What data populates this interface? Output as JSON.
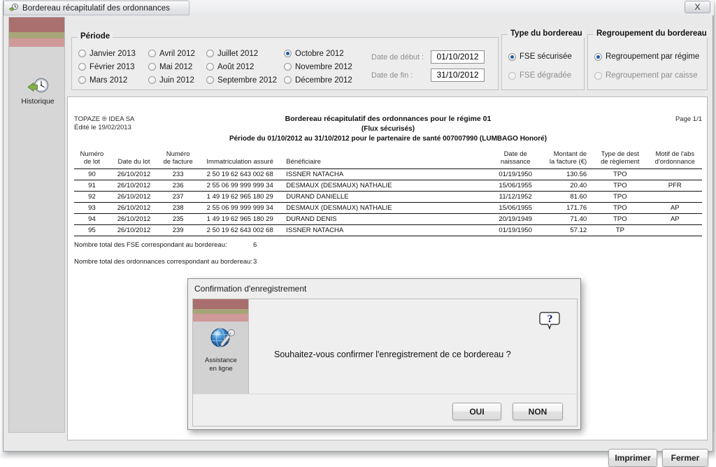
{
  "window": {
    "title": "Bordereau récapitulatif des ordonnances",
    "title_icon": "app-icon",
    "close_label": "X"
  },
  "sidebar": {
    "items": [
      {
        "label": "Historique",
        "icon": "clock-history-icon"
      }
    ]
  },
  "periode": {
    "legend": "Période",
    "months": [
      {
        "label": "Janvier 2013",
        "selected": false
      },
      {
        "label": "Avril 2012",
        "selected": false
      },
      {
        "label": "Juillet 2012",
        "selected": false
      },
      {
        "label": "Octobre 2012",
        "selected": true
      },
      {
        "label": "Février 2013",
        "selected": false
      },
      {
        "label": "Mai 2012",
        "selected": false
      },
      {
        "label": "Août 2012",
        "selected": false
      },
      {
        "label": "Novembre 2012",
        "selected": false
      },
      {
        "label": "Mars 2012",
        "selected": false
      },
      {
        "label": "Juin 2012",
        "selected": false
      },
      {
        "label": "Septembre 2012",
        "selected": false
      },
      {
        "label": "Décembre 2012",
        "selected": false
      }
    ],
    "date_debut_label": "Date de début :",
    "date_debut_value": "01/10/2012",
    "date_fin_label": "Date de fin :",
    "date_fin_value": "31/10/2012"
  },
  "type_bordereau": {
    "legend": "Type du bordereau",
    "options": [
      {
        "label": "FSE sécurisée",
        "selected": true
      },
      {
        "label": "FSE dégradée",
        "selected": false
      }
    ]
  },
  "regroupement": {
    "legend": "Regroupement du bordereau",
    "options": [
      {
        "label": "Regroupement par régime",
        "selected": true
      },
      {
        "label": "Regroupement par caisse",
        "selected": false
      }
    ]
  },
  "report": {
    "company": "TOPAZE ® IDEA SA",
    "edited": "Édité le  19/02/2013",
    "page": "Page 1/1",
    "title": "Bordereau récapitulatif des ordonnances pour le régime 01",
    "subtitle": "(Flux sécurisés)",
    "period_line": "Période du 01/10/2012 au 31/10/2012 pour le partenaire de santé 007007990 (LUMBAGO Honoré)",
    "columns": [
      {
        "line1": "Numéro",
        "line2": "de lot"
      },
      {
        "line1": "Date du lot",
        "line2": ""
      },
      {
        "line1": "Numéro",
        "line2": "de facture"
      },
      {
        "line1": "Immatriculation assuré",
        "line2": ""
      },
      {
        "line1": "Bénéficiaire",
        "line2": ""
      },
      {
        "line1": "Date de",
        "line2": "naissance"
      },
      {
        "line1": "Montant de",
        "line2": "la facture (€)"
      },
      {
        "line1": "Type de dest",
        "line2": "de règlement"
      },
      {
        "line1": "Motif de l'abs",
        "line2": "d'ordonnance"
      }
    ],
    "rows": [
      {
        "numero_lot": "90",
        "date_lot": "26/10/2012",
        "numero_facture": "233",
        "immatriculation": "2 50 19 62 643 002 68",
        "beneficiaire": "ISSNER NATACHA",
        "date_naissance": "01/19/1950",
        "montant": "130.56",
        "type_dest": "TPO",
        "motif": ""
      },
      {
        "numero_lot": "91",
        "date_lot": "26/10/2012",
        "numero_facture": "236",
        "immatriculation": "2 55 06 99 999 999 34",
        "beneficiaire": "DESMAUX (DESMAUX) NATHALIE",
        "date_naissance": "15/06/1955",
        "montant": "20.40",
        "type_dest": "TPO",
        "motif": "PFR"
      },
      {
        "numero_lot": "92",
        "date_lot": "26/10/2012",
        "numero_facture": "237",
        "immatriculation": "1 49 19 62 965 180 29",
        "beneficiaire": "DURAND DANIELLE",
        "date_naissance": "11/12/1952",
        "montant": "81.60",
        "type_dest": "TPO",
        "motif": ""
      },
      {
        "numero_lot": "93",
        "date_lot": "26/10/2012",
        "numero_facture": "238",
        "immatriculation": "2 55 06 99 999 999 34",
        "beneficiaire": "DESMAUX (DESMAUX) NATHALIE",
        "date_naissance": "15/06/1955",
        "montant": "171.76",
        "type_dest": "TPO",
        "motif": "AP"
      },
      {
        "numero_lot": "94",
        "date_lot": "26/10/2012",
        "numero_facture": "235",
        "immatriculation": "1 49 19 62 965 180 29",
        "beneficiaire": "DURAND DENIS",
        "date_naissance": "20/19/1949",
        "montant": "71.40",
        "type_dest": "TPO",
        "motif": "AP"
      },
      {
        "numero_lot": "95",
        "date_lot": "26/10/2012",
        "numero_facture": "239",
        "immatriculation": "2 50 19 62 643 002 68",
        "beneficiaire": "ISSNER NATACHA",
        "date_naissance": "01/19/1950",
        "montant": "57.12",
        "type_dest": "TP",
        "motif": ""
      }
    ],
    "total_fse_label": "Nombre total des FSE correspondant au bordereau:",
    "total_fse_value": "6",
    "total_ord_label": "Nombre total des ordonnances correspondant au bordereau:",
    "total_ord_value": "3"
  },
  "dialog": {
    "title": "Confirmation d'enregistrement",
    "message": "Souhaitez-vous confirmer l'enregistrement de ce bordereau ?",
    "assistance_line1": "Assistance",
    "assistance_line2": "en ligne",
    "help_icon": "question-mark-balloon-icon",
    "yes_label": "OUI",
    "no_label": "NON"
  },
  "footer": {
    "print_label": "Imprimer",
    "close_label": "Fermer"
  },
  "colors": {
    "accent": "#1f5fa8",
    "window_bg": "#e8e8e8",
    "report_bg": "#ffffff",
    "nav_band_red": "#a25d5d",
    "nav_band_olive": "#9c9a60",
    "nav_band_pink": "#cf8f8f"
  }
}
